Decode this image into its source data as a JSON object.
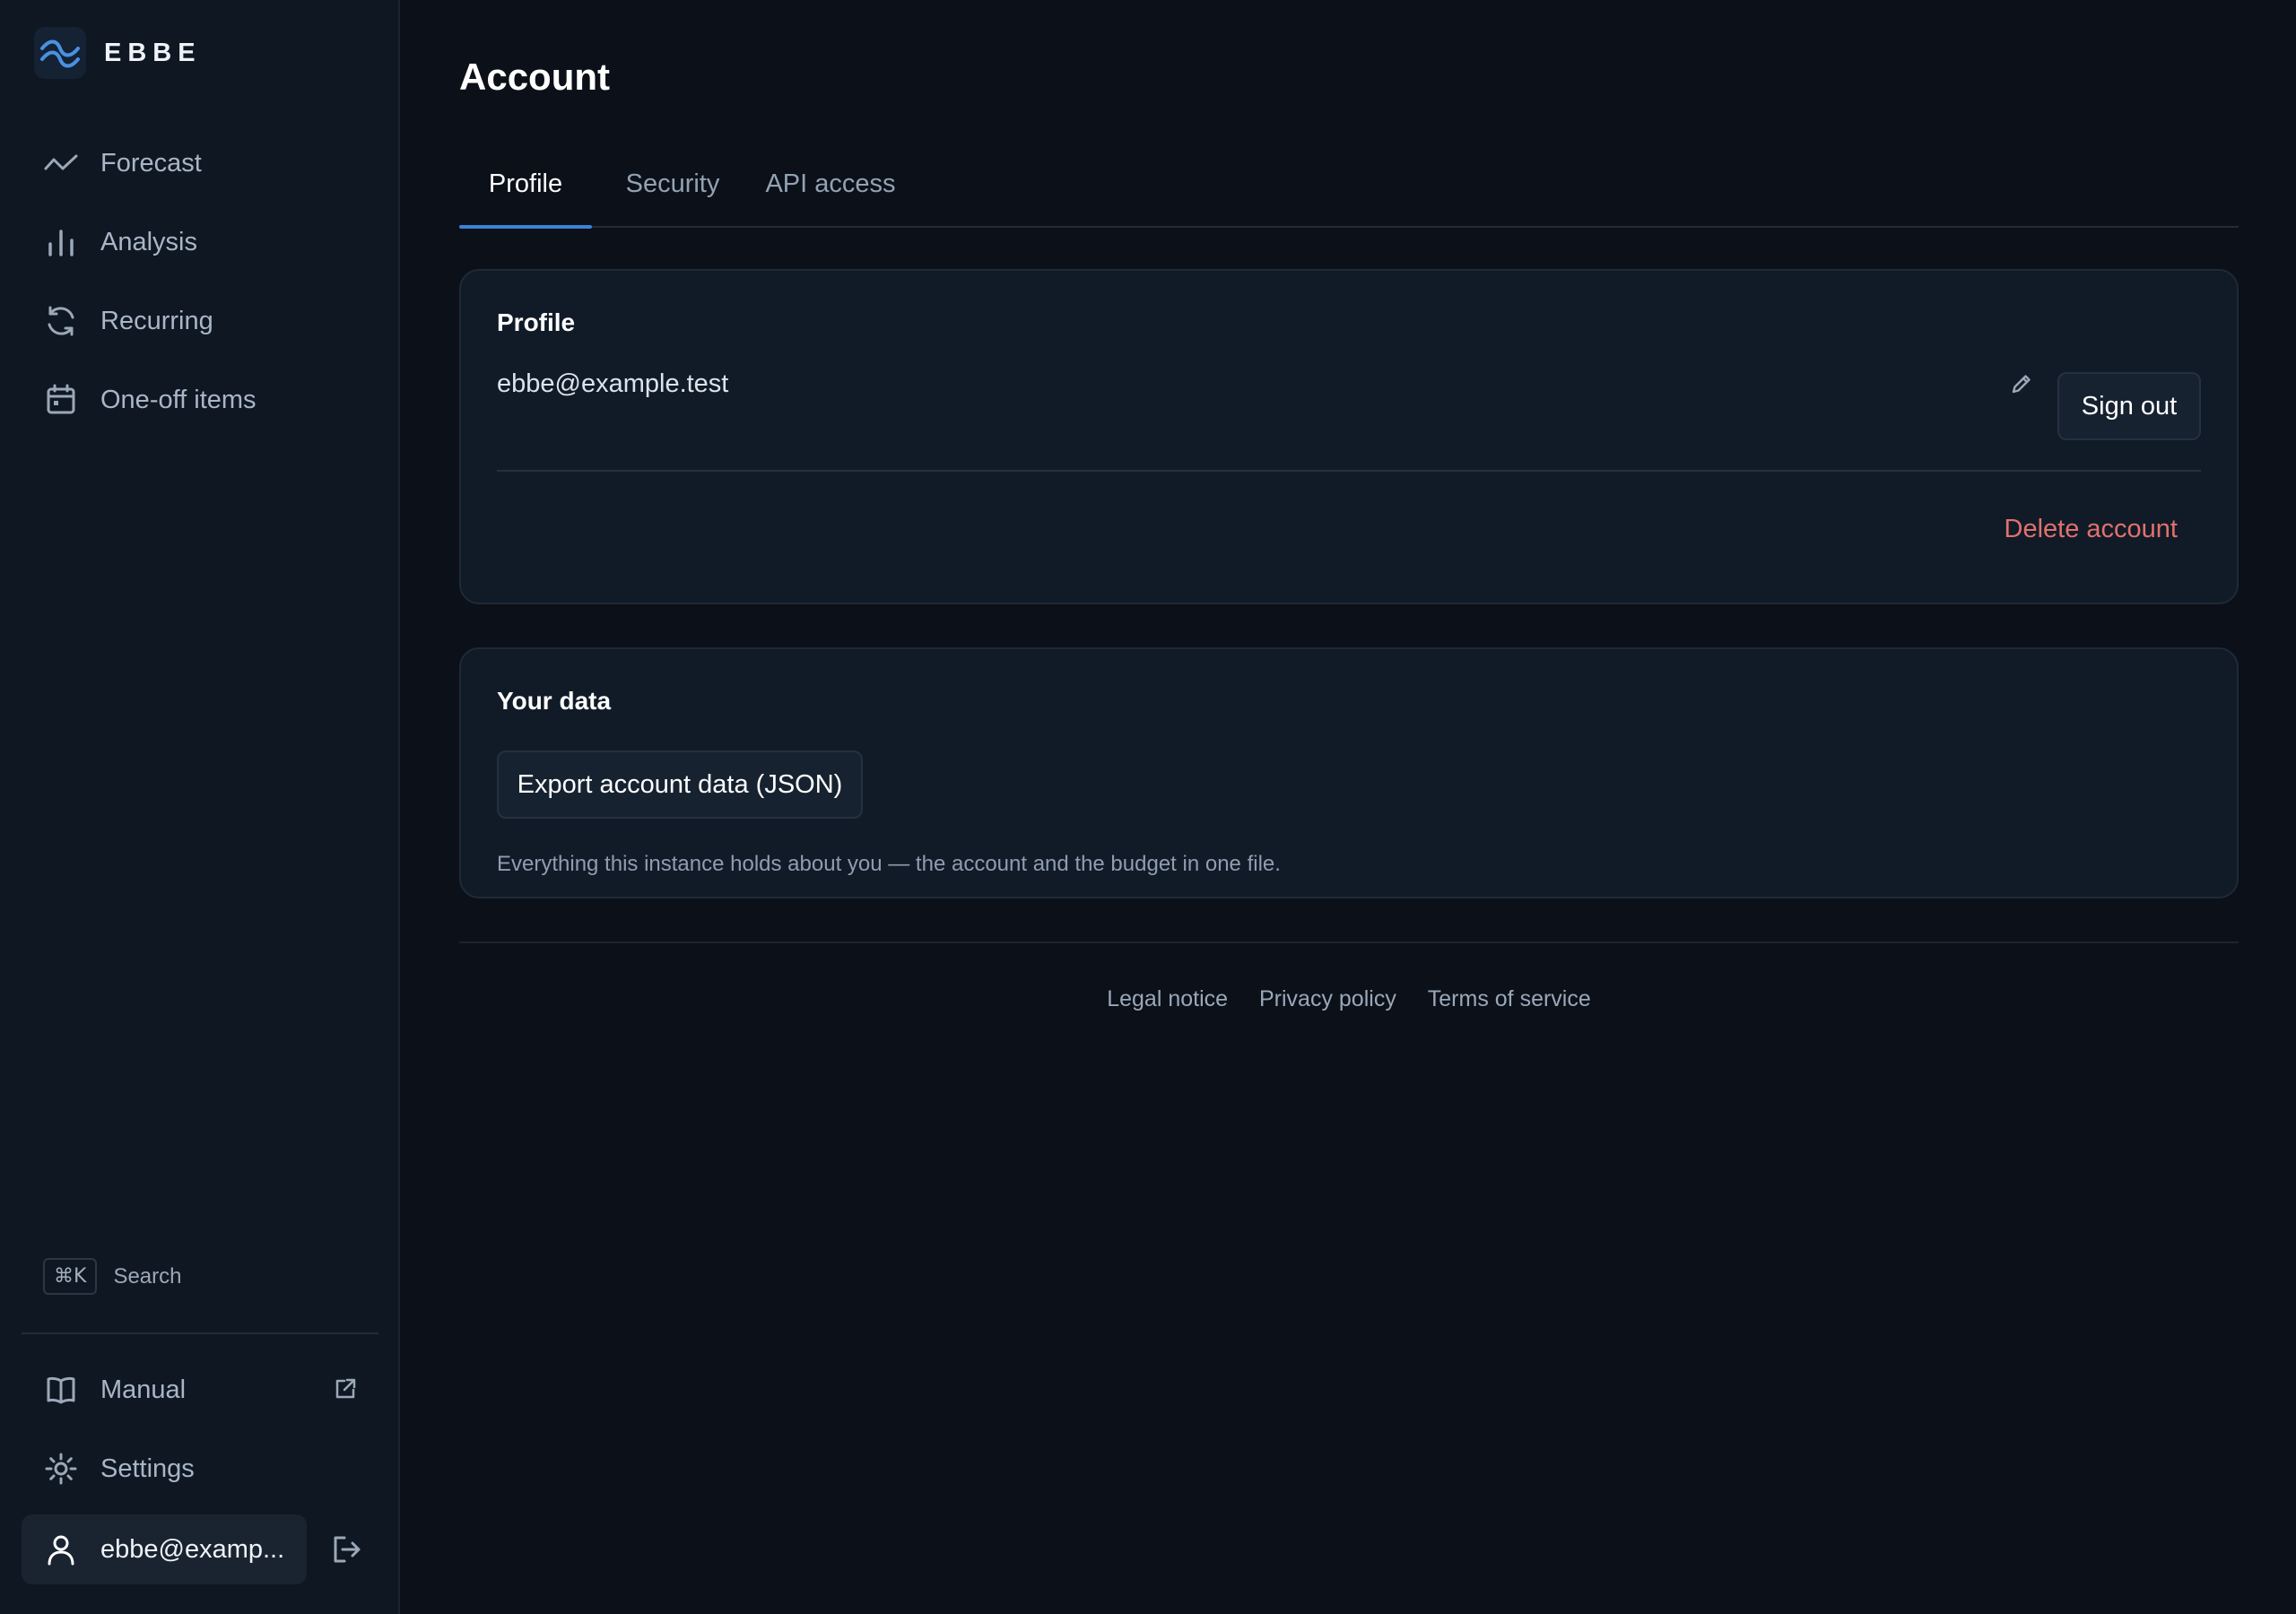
{
  "brand": {
    "name": "EBBE"
  },
  "sidebar": {
    "nav": [
      {
        "label": "Forecast",
        "icon": "trend-line-icon"
      },
      {
        "label": "Analysis",
        "icon": "bar-chart-icon"
      },
      {
        "label": "Recurring",
        "icon": "refresh-icon"
      },
      {
        "label": "One-off items",
        "icon": "calendar-icon"
      }
    ],
    "search": {
      "shortcut": "⌘K",
      "label": "Search"
    },
    "bottom": [
      {
        "label": "Manual",
        "icon": "book-icon"
      },
      {
        "label": "Settings",
        "icon": "sun-gear-icon"
      }
    ],
    "user": {
      "label": "ebbe@examp..."
    }
  },
  "page": {
    "title": "Account"
  },
  "tabs": [
    {
      "label": "Profile",
      "active": true
    },
    {
      "label": "Security",
      "active": false
    },
    {
      "label": "API access",
      "active": false
    }
  ],
  "profile_card": {
    "title": "Profile",
    "email": "ebbe@example.test",
    "sign_out_label": "Sign out",
    "delete_label": "Delete account"
  },
  "data_card": {
    "title": "Your data",
    "export_label": "Export account data (JSON)",
    "help": "Everything this instance holds about you — the account and the budget in one file."
  },
  "footer": {
    "links": [
      "Legal notice",
      "Privacy policy",
      "Terms of service"
    ]
  },
  "colors": {
    "accent": "#3b82d6",
    "danger": "#e0716e",
    "background": "#0b1019",
    "sidebar": "#0f1722",
    "card": "#111b27"
  }
}
